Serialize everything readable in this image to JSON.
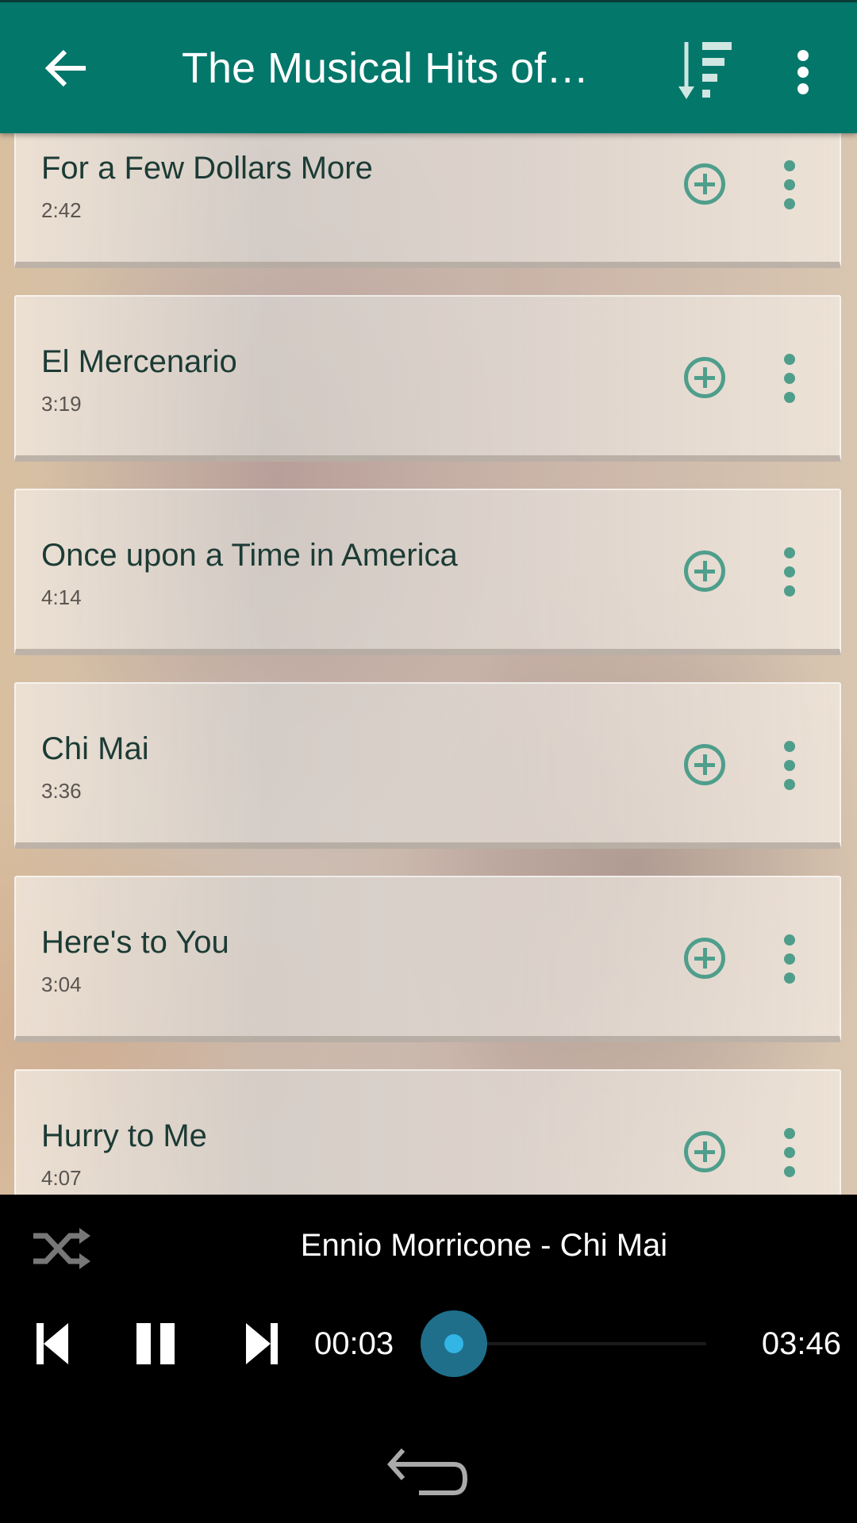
{
  "header": {
    "title": "The Musical Hits of…"
  },
  "tracks": [
    {
      "title": "For a Few Dollars More",
      "duration": "2:42"
    },
    {
      "title": "El Mercenario",
      "duration": "3:19"
    },
    {
      "title": "Once upon a Time in America",
      "duration": "4:14"
    },
    {
      "title": "Chi Mai",
      "duration": "3:36"
    },
    {
      "title": "Here's to You",
      "duration": "3:04"
    },
    {
      "title": "Hurry to Me",
      "duration": "4:07"
    }
  ],
  "player": {
    "now_playing": "Ennio Morricone - Chi Mai",
    "elapsed": "00:03",
    "total": "03:46",
    "progress_fraction": 0.013
  },
  "colors": {
    "accent": "#02776a",
    "icon": "#4f9e8c",
    "seek": "#33b5e5"
  }
}
